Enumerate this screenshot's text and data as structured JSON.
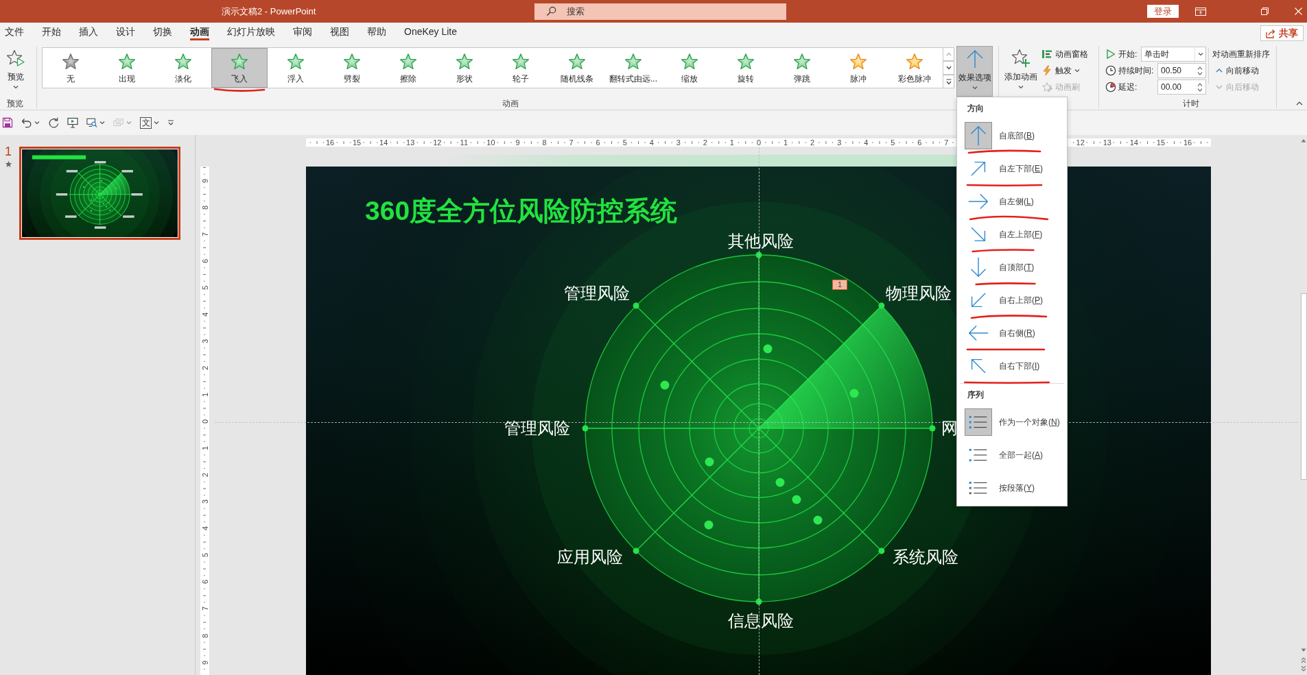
{
  "window": {
    "title": "演示文稿2 - PowerPoint",
    "search": {
      "placeholder": "搜索"
    },
    "sign_in": "登录"
  },
  "ribbon_tabs": [
    {
      "label": "文件",
      "selected": false
    },
    {
      "label": "开始",
      "selected": false
    },
    {
      "label": "插入",
      "selected": false
    },
    {
      "label": "设计",
      "selected": false
    },
    {
      "label": "切换",
      "selected": false
    },
    {
      "label": "动画",
      "selected": true
    },
    {
      "label": "幻灯片放映",
      "selected": false
    },
    {
      "label": "审阅",
      "selected": false
    },
    {
      "label": "视图",
      "selected": false
    },
    {
      "label": "帮助",
      "selected": false
    },
    {
      "label": "OneKey Lite",
      "selected": false
    }
  ],
  "share_button": "共享",
  "ribbon": {
    "preview_group": {
      "button": "预览",
      "label": "预览"
    },
    "animation_group": {
      "label": "动画",
      "effects": [
        {
          "label": "无",
          "kind": "none",
          "selected": false,
          "underlined": false
        },
        {
          "label": "出现",
          "kind": "entrance",
          "selected": false,
          "underlined": false
        },
        {
          "label": "淡化",
          "kind": "entrance",
          "selected": false,
          "underlined": false
        },
        {
          "label": "飞入",
          "kind": "entrance",
          "selected": true,
          "underlined": true
        },
        {
          "label": "浮入",
          "kind": "entrance",
          "selected": false,
          "underlined": false
        },
        {
          "label": "劈裂",
          "kind": "entrance",
          "selected": false,
          "underlined": false
        },
        {
          "label": "擦除",
          "kind": "entrance",
          "selected": false,
          "underlined": false
        },
        {
          "label": "形状",
          "kind": "entrance",
          "selected": false,
          "underlined": false
        },
        {
          "label": "轮子",
          "kind": "entrance",
          "selected": false,
          "underlined": false
        },
        {
          "label": "随机线条",
          "kind": "entrance",
          "selected": false,
          "underlined": false
        },
        {
          "label": "翻转式由远...",
          "kind": "entrance",
          "selected": false,
          "underlined": false
        },
        {
          "label": "缩放",
          "kind": "entrance",
          "selected": false,
          "underlined": false
        },
        {
          "label": "旋转",
          "kind": "entrance",
          "selected": false,
          "underlined": false
        },
        {
          "label": "弹跳",
          "kind": "entrance",
          "selected": false,
          "underlined": false
        },
        {
          "label": "脉冲",
          "kind": "emphasis",
          "selected": false,
          "underlined": false
        },
        {
          "label": "彩色脉冲",
          "kind": "emphasis",
          "selected": false,
          "underlined": false
        }
      ],
      "effect_options": {
        "label": "效果选项",
        "expanded": true
      }
    },
    "advanced_group": {
      "add_animation": "添加动画",
      "commands": [
        {
          "label": "动画窗格",
          "kind": "pane",
          "dropdown": false,
          "disabled": false
        },
        {
          "label": "触发",
          "kind": "trigger",
          "dropdown": true,
          "disabled": false
        },
        {
          "label": "动画刷",
          "kind": "painter",
          "dropdown": false,
          "disabled": true
        }
      ]
    },
    "timing_group": {
      "label": "计时",
      "start": {
        "label": "开始:",
        "value": "单击时"
      },
      "duration": {
        "label": "持续时间:",
        "value": "00.50"
      },
      "delay": {
        "label": "延迟:",
        "value": "00.00"
      },
      "reorder": {
        "title": "对动画重新排序",
        "commands": [
          {
            "label": "向前移动",
            "kind": "earlier",
            "disabled": false
          },
          {
            "label": "向后移动",
            "kind": "later",
            "disabled": true
          }
        ]
      }
    }
  },
  "quick_access": [
    {
      "kind": "save",
      "dropdown": false,
      "disabled": false
    },
    {
      "kind": "undo",
      "dropdown": true,
      "disabled": false
    },
    {
      "kind": "redo",
      "dropdown": false,
      "disabled": false
    },
    {
      "kind": "from-start",
      "dropdown": false,
      "disabled": false
    },
    {
      "kind": "monitor",
      "dropdown": true,
      "disabled": false
    },
    {
      "kind": "stack",
      "dropdown": true,
      "disabled": true
    },
    {
      "kind": "glyph",
      "label": "文",
      "dropdown": true,
      "disabled": false
    },
    {
      "kind": "customize",
      "dropdown": false,
      "disabled": false
    }
  ],
  "slides_panel": {
    "slides": [
      {
        "number": "1",
        "selected": true,
        "animated": true
      }
    ]
  },
  "rulers": {
    "horizontal": [
      "16",
      "15",
      "14",
      "13",
      "12",
      "11",
      "10",
      "9",
      "8",
      "7",
      "6",
      "5",
      "4",
      "3",
      "2",
      "1",
      "0",
      "1",
      "2",
      "3",
      "4",
      "5",
      "6",
      "7",
      "12",
      "13",
      "14",
      "15",
      "16"
    ],
    "vertical": [
      "9",
      "8",
      "7",
      "6",
      "5",
      "4",
      "3",
      "2",
      "1",
      "0",
      "1",
      "2",
      "3",
      "4",
      "5",
      "6",
      "7",
      "8",
      "9"
    ]
  },
  "slide": {
    "title": "360度全方位风险防控系统",
    "labels": [
      "其他风险",
      "管理风险",
      "物理风险",
      "管理风险",
      "网",
      "应用风险",
      "系统风险",
      "信息风险"
    ],
    "animation_tag": "1"
  },
  "effect_menu": {
    "sections": [
      {
        "title": "方向",
        "items": [
          {
            "label": "自底部(B)",
            "kind": "up",
            "selected": true,
            "underlined": true
          },
          {
            "label": "自左下部(E)",
            "kind": "up-right",
            "selected": false,
            "underlined": true
          },
          {
            "label": "自左侧(L)",
            "kind": "right",
            "selected": false,
            "underlined": true
          },
          {
            "label": "自左上部(F)",
            "kind": "down-right",
            "selected": false,
            "underlined": true
          },
          {
            "label": "自顶部(T)",
            "kind": "down",
            "selected": false,
            "underlined": true
          },
          {
            "label": "自右上部(P)",
            "kind": "down-left",
            "selected": false,
            "underlined": true
          },
          {
            "label": "自右侧(R)",
            "kind": "left",
            "selected": false,
            "underlined": true
          },
          {
            "label": "自右下部(I)",
            "kind": "up-left",
            "selected": false,
            "underlined": true
          }
        ]
      },
      {
        "title": "序列",
        "items": [
          {
            "label": "作为一个对象(N)",
            "kind": "as-one",
            "selected": true,
            "underlined": false
          },
          {
            "label": "全部一起(A)",
            "kind": "all-at-once",
            "selected": false,
            "underlined": false
          },
          {
            "label": "按段落(Y)",
            "kind": "by-paragraph",
            "selected": false,
            "underlined": false
          }
        ]
      }
    ]
  }
}
